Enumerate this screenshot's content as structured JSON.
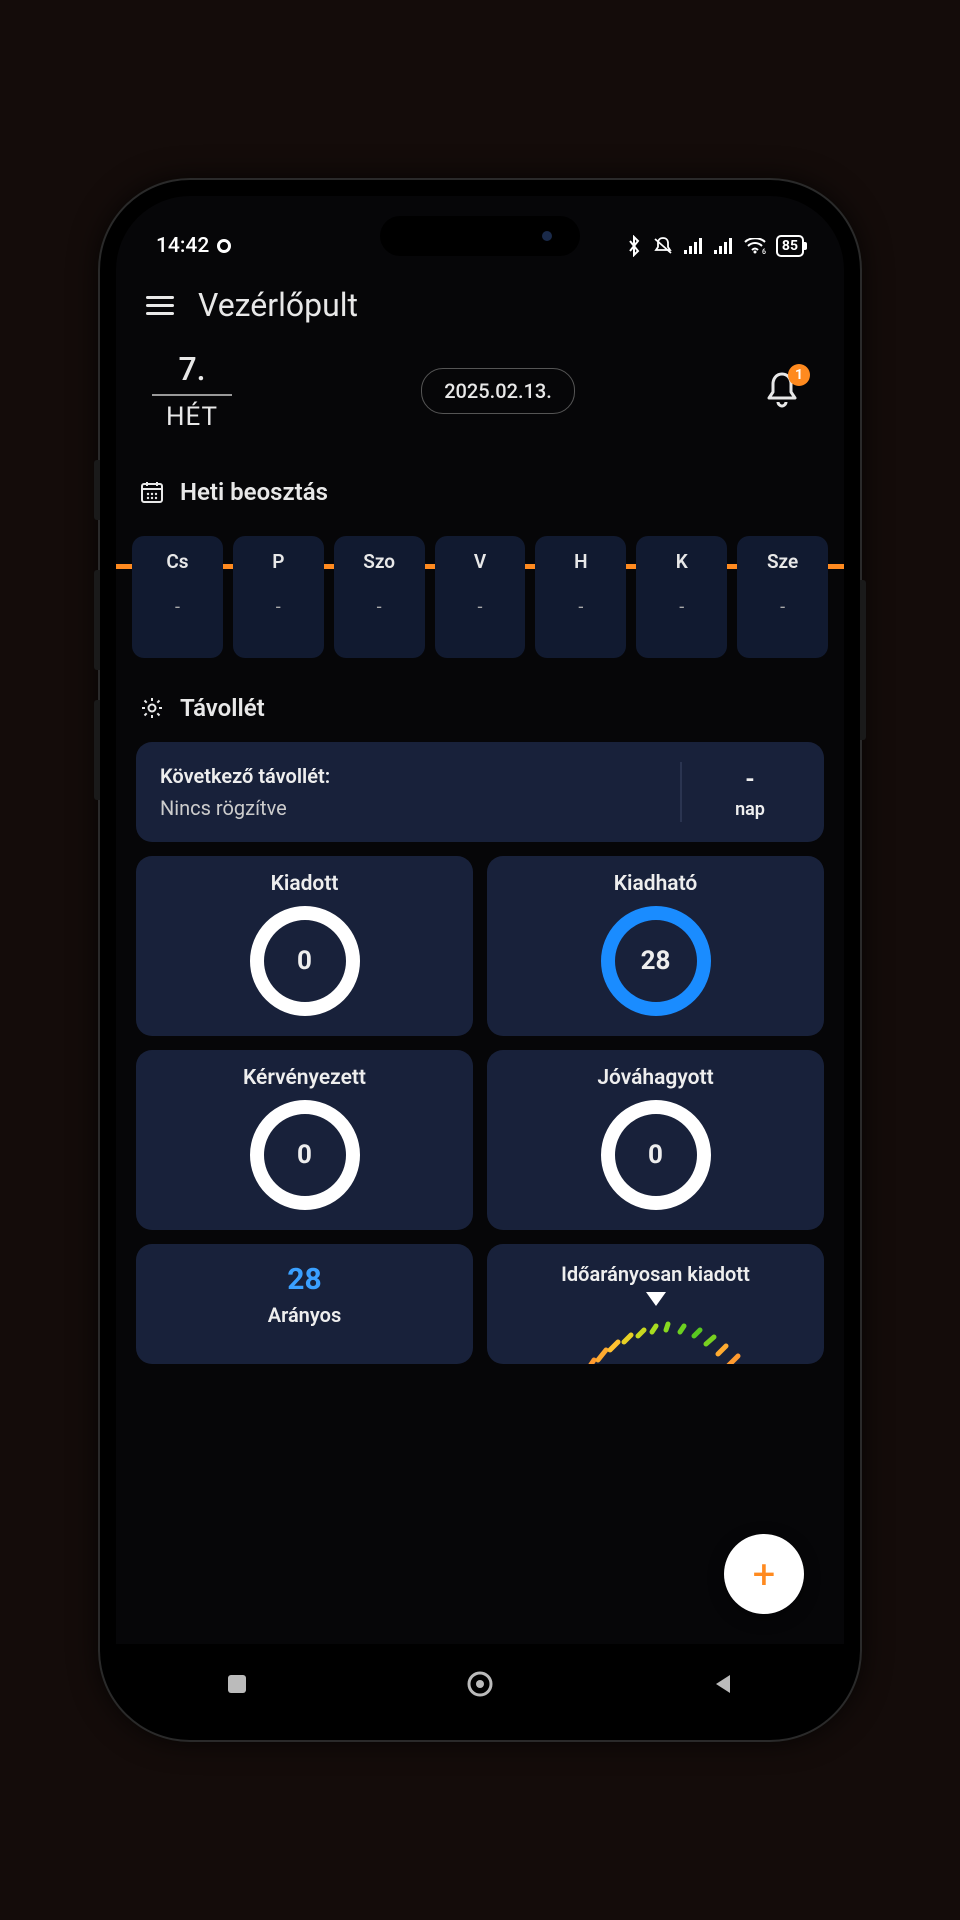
{
  "status": {
    "time": "14:42",
    "battery": "85"
  },
  "header": {
    "title": "Vezérlőpult"
  },
  "top": {
    "week_number": "7.",
    "week_label": "HÉT",
    "date": "2025.02.13.",
    "notification_count": "1"
  },
  "schedule": {
    "title": "Heti beosztás",
    "days": [
      {
        "abbr": "Cs",
        "value": "-"
      },
      {
        "abbr": "P",
        "value": "-"
      },
      {
        "abbr": "Szo",
        "value": "-"
      },
      {
        "abbr": "V",
        "value": "-"
      },
      {
        "abbr": "H",
        "value": "-"
      },
      {
        "abbr": "K",
        "value": "-"
      },
      {
        "abbr": "Sze",
        "value": "-"
      }
    ]
  },
  "absence": {
    "title": "Távollét",
    "next_label": "Következő távollét:",
    "next_value": "Nincs rögzítve",
    "days_value": "-",
    "days_unit": "nap",
    "stats": {
      "issued": {
        "label": "Kiadott",
        "value": "0",
        "color": "white"
      },
      "available": {
        "label": "Kiadható",
        "value": "28",
        "color": "blue"
      },
      "requested": {
        "label": "Kérvényezett",
        "value": "0",
        "color": "white"
      },
      "approved": {
        "label": "Jóváhagyott",
        "value": "0",
        "color": "white"
      }
    },
    "proportional": {
      "value": "28",
      "label": "Arányos"
    },
    "gauge": {
      "label": "Időarányosan kiadott"
    }
  },
  "colors": {
    "accent_orange": "#ff8a1f",
    "accent_blue": "#1a8cff",
    "card_bg": "#18213a",
    "day_bg": "#111a30"
  }
}
